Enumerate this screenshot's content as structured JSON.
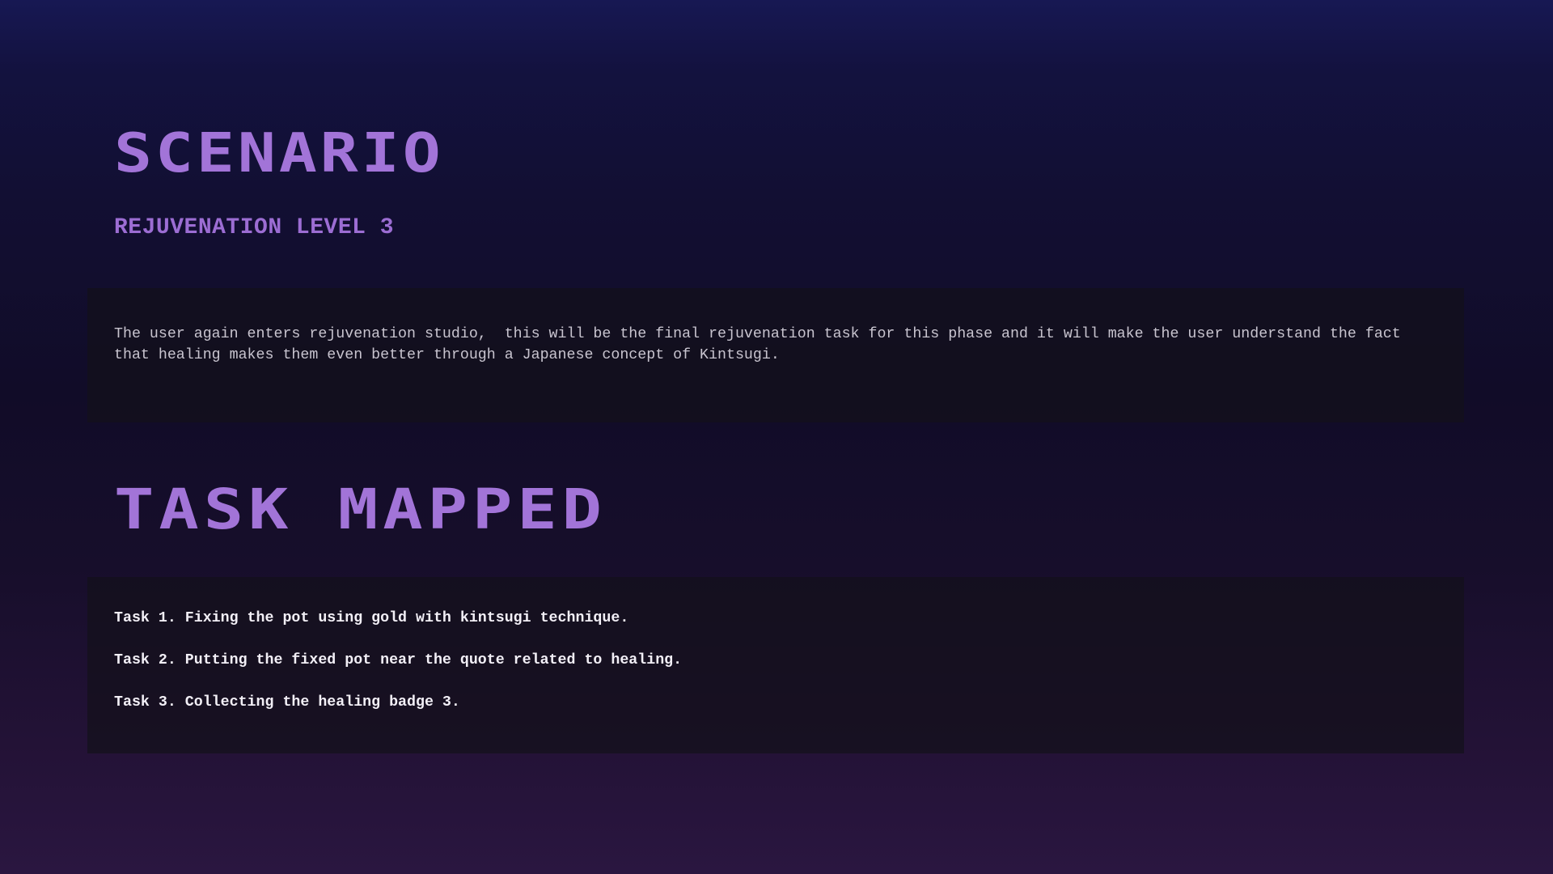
{
  "scenario": {
    "title": "SCENARIO",
    "subtitle": "REJUVENATION LEVEL 3",
    "description": "The user again enters rejuvenation studio,  this will be the final rejuvenation task for this phase and it will make the user understand the fact that healing makes them even better through a Japanese concept of Kintsugi."
  },
  "task_mapped": {
    "title": "TASK MAPPED",
    "tasks": [
      "Task 1. Fixing the pot using gold with kintsugi technique.",
      "Task 2. Putting the fixed pot near the quote related to healing.",
      "Task 3. Collecting the healing badge 3."
    ]
  },
  "colors": {
    "accent": "#a274d8",
    "background_top": "#171853",
    "background_bottom": "#2a1640",
    "panel": "#14111b",
    "body_text": "#c8c4cf",
    "task_text": "#f2eff6"
  }
}
